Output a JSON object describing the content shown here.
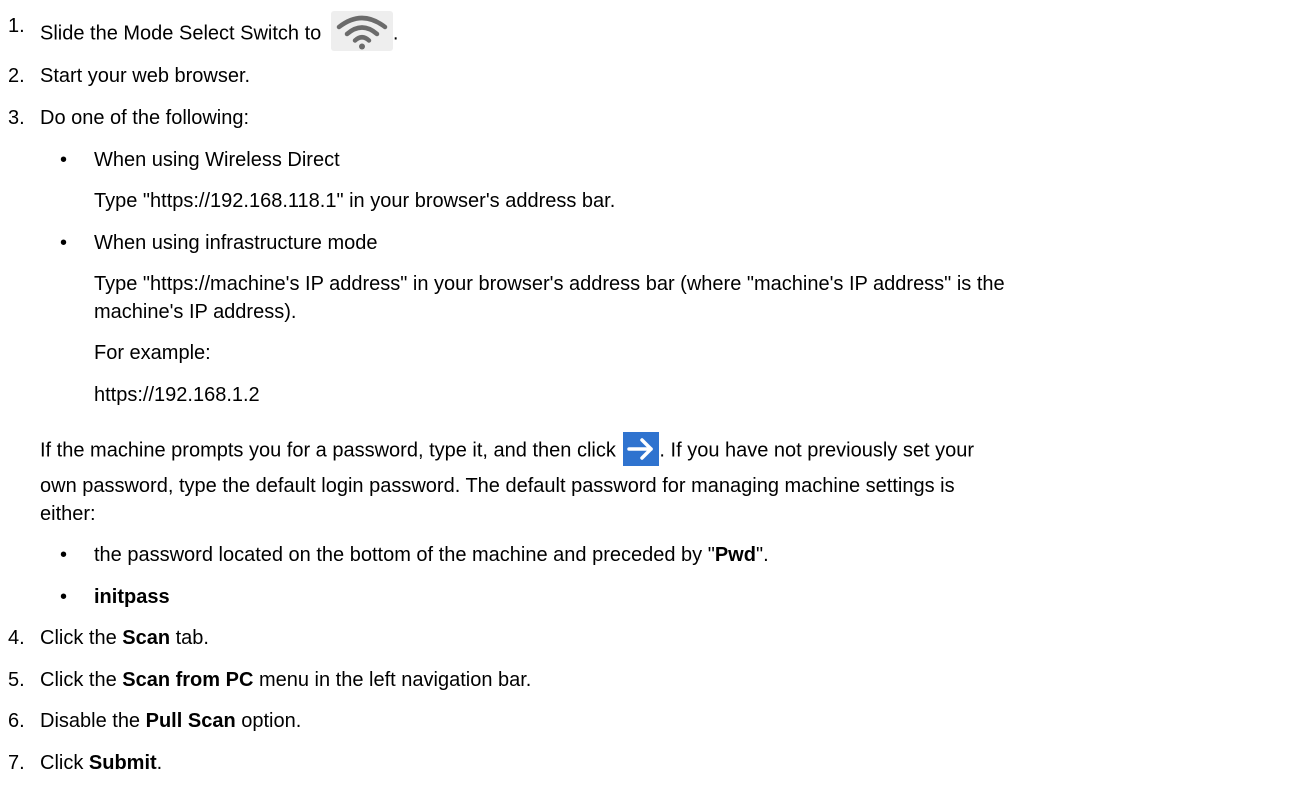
{
  "steps": {
    "s1": {
      "num": "1.",
      "text": "Slide the Mode Select Switch to",
      "after": "."
    },
    "s2": {
      "num": "2.",
      "text": "Start your web browser."
    },
    "s3": {
      "num": "3.",
      "text": "Do one of the following:"
    },
    "wd": {
      "bullet": "•",
      "title": "When using Wireless Direct",
      "desc": "Type \"https://192.168.118.1\" in your browser's address bar."
    },
    "infra": {
      "bullet": "•",
      "title": "When using infrastructure mode",
      "desc1": "Type \"https://machine's IP address\" in your browser's address bar (where \"machine's IP address\" is the",
      "desc2": "machine's IP address).",
      "example_label": "For example:",
      "example_url": "https://192.168.1.2"
    },
    "pw": {
      "line1_pre": "If the machine prompts you for a password, type it, and then click",
      "line1_post": ". If you have not previously set your",
      "line2": "own password, type the default login password. The default password for managing machine settings is",
      "line3": "either:"
    },
    "pw_opts": {
      "bullet": "•",
      "opt1_pre": "the password located on the bottom of the machine and preceded by \"",
      "opt1_bold": "Pwd",
      "opt1_post": "\".",
      "opt2": "initpass"
    },
    "s4": {
      "num": "4.",
      "pre": "Click the ",
      "bold": "Scan",
      "post": " tab."
    },
    "s5": {
      "num": "5.",
      "pre": "Click the ",
      "bold": "Scan from PC",
      "post": " menu in the left navigation bar."
    },
    "s6": {
      "num": "6.",
      "pre": "Disable the ",
      "bold": "Pull Scan",
      "post": " option."
    },
    "s7": {
      "num": "7.",
      "pre": "Click ",
      "bold": "Submit",
      "post": "."
    }
  },
  "icons": {
    "wifi": "wifi-icon",
    "arrow": "arrow-right-icon",
    "wifi_color": "#6b6b6b",
    "wifi_bg": "#eeeeee",
    "arrow_bg": "#2f73cf"
  }
}
